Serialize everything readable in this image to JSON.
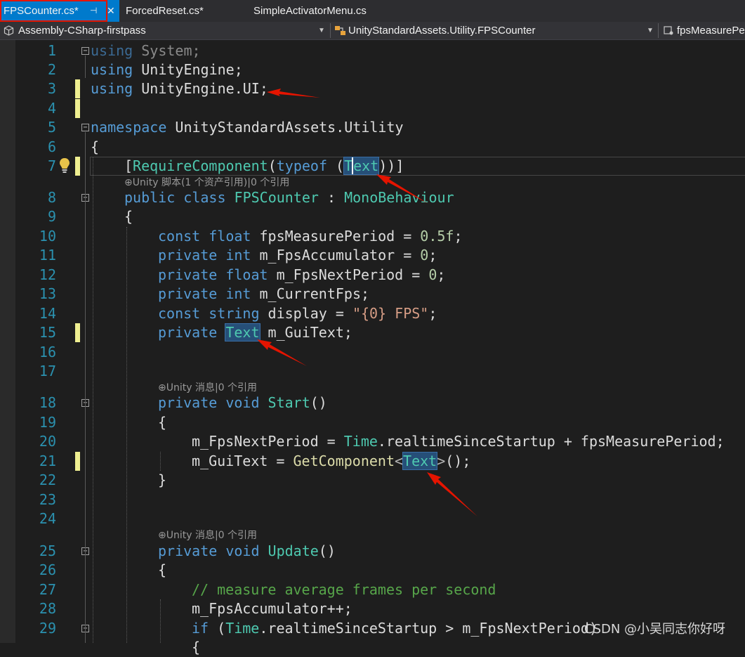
{
  "tabs": [
    {
      "label": "FPSCounter.cs*",
      "active": true,
      "pin": "⊣",
      "close": "✕"
    },
    {
      "label": "ForcedReset.cs*"
    },
    {
      "label": "SimpleActivatorMenu.cs"
    }
  ],
  "navbar": {
    "project": "Assembly-CSharp-firstpass",
    "type": "UnityStandardAssets.Utility.FPSCounter",
    "member": "fpsMeasurePe"
  },
  "line_numbers": [
    "1",
    "2",
    "3",
    "4",
    "5",
    "6",
    "7",
    "8",
    "9",
    "10",
    "11",
    "12",
    "13",
    "14",
    "15",
    "16",
    "17",
    "18",
    "19",
    "20",
    "21",
    "22",
    "23",
    "24",
    "25",
    "26",
    "27",
    "28",
    "29"
  ],
  "code": {
    "l1_kw": "using",
    "l1_rest": " System;",
    "l2_kw": "using",
    "l2_rest": " UnityEngine;",
    "l3_kw": "using",
    "l3_rest": " UnityEngine.UI;",
    "l5_kw": "namespace",
    "l5_rest": " UnityStandardAssets.Utility",
    "l6": "{",
    "l7_a": "[",
    "l7_attr": "RequireComponent",
    "l7_b": "(",
    "l7_kw": "typeof",
    "l7_c": " (",
    "l7_t": "T",
    "l7_ext": "ext",
    "l7_d": "))]",
    "l8_kw": "public class",
    "l8_sp": " ",
    "l8_cls": "FPSCounter",
    "l8_colon": " : ",
    "l8_base": "MonoBehaviour",
    "l9": "{",
    "l10_kw": "const float",
    "l10_rest": " fpsMeasurePeriod = ",
    "l10_num": "0.5f",
    "l10_end": ";",
    "l11_kw": "private int",
    "l11_rest": " m_FpsAccumulator = ",
    "l11_num": "0",
    "l11_end": ";",
    "l12_kw": "private float",
    "l12_rest": " m_FpsNextPeriod = ",
    "l12_num": "0",
    "l12_end": ";",
    "l13_kw": "private int",
    "l13_rest": " m_CurrentFps;",
    "l14_kw": "const string",
    "l14_rest": " display = ",
    "l14_str": "\"{0} FPS\"",
    "l14_end": ";",
    "l15_kw": "private",
    "l15_sp": " ",
    "l15_type": "Text",
    "l15_rest": " m_GuiText;",
    "l18_kw": "private void",
    "l18_sp": " ",
    "l18_fn": "Start",
    "l18_rest": "()",
    "l19": "{",
    "l20_a": "m_FpsNextPeriod = ",
    "l20_t": "Time",
    "l20_b": ".realtimeSinceStartup + fpsMeasurePeriod;",
    "l21_a": "m_GuiText = ",
    "l21_fn": "GetComponent",
    "l21_lt": "<",
    "l21_t": "Text",
    "l21_gt": ">",
    "l21_b": "();",
    "l22": "}",
    "l25_kw": "private void",
    "l25_sp": " ",
    "l25_fn": "Update",
    "l25_rest": "()",
    "l26": "{",
    "l27_cm": "// measure average frames per second",
    "l28": "m_FpsAccumulator++;",
    "l29_kw": "if",
    "l29_a": " (",
    "l29_t": "Time",
    "l29_b": ".realtimeSinceStartup > m_FpsNextPeriod)"
  },
  "codelens": {
    "l7": "⊕Unity 脚本(1 个资产引用)|0 个引用",
    "l17": "⊕Unity 消息|0 个引用",
    "l24": "⊕Unity 消息|0 个引用"
  },
  "watermark": "CSDN @小吴同志你好呀",
  "colors": {
    "keyword": "#569cd6",
    "type": "#4ec9b0",
    "string": "#d69d85",
    "number": "#b5cea8",
    "comment": "#57a64a",
    "method": "#dcdcaa",
    "line_number": "#2b91af",
    "active_tab": "#007acc",
    "annotation_red": "#e51400"
  }
}
